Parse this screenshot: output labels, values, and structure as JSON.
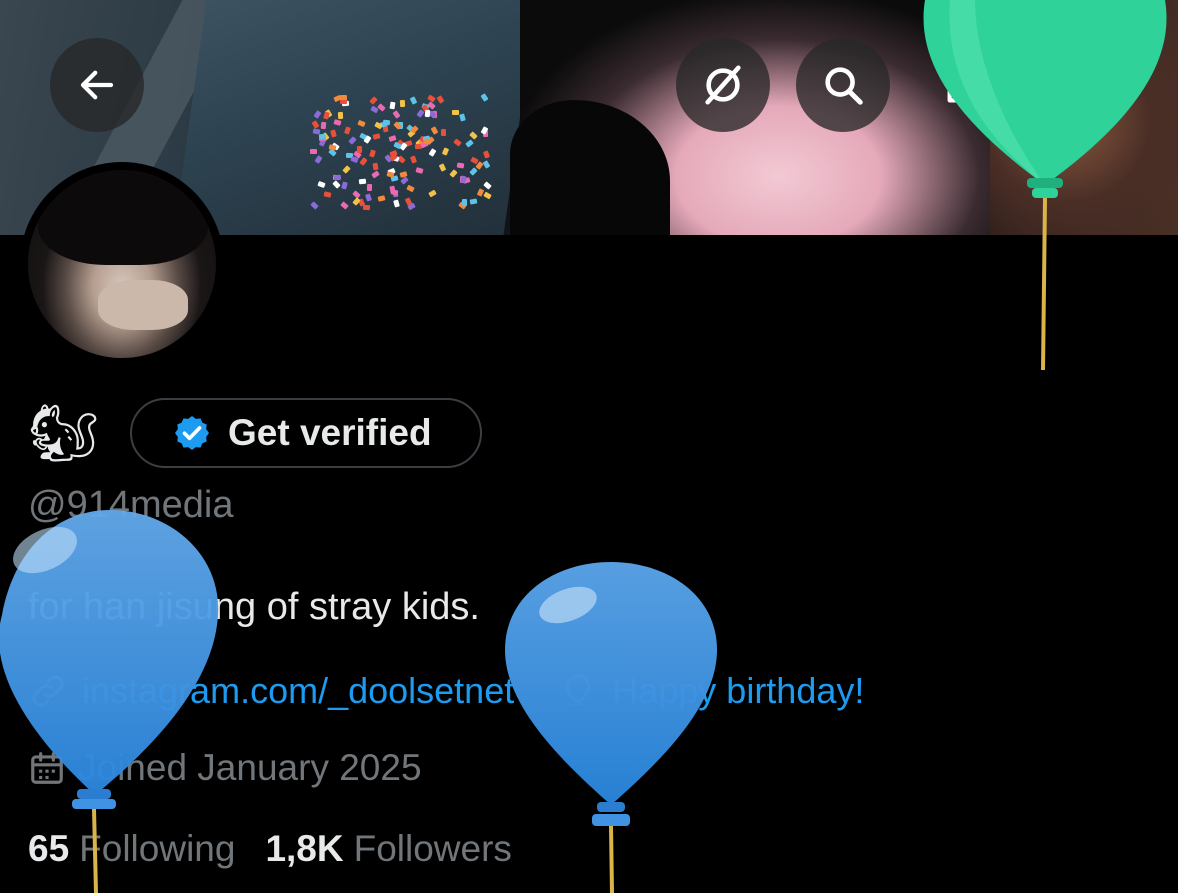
{
  "header": {
    "back_icon": "arrow-left-icon",
    "actions": [
      "grok-icon",
      "search-icon",
      "edit-icon",
      "share-icon"
    ]
  },
  "profile": {
    "display_name_emoji": "🐿",
    "get_verified_label": "Get verified",
    "handle": "@914media",
    "bio": "for han jisung of stray kids.",
    "link": "instagram.com/_doolsetnet",
    "birthday": "Happy birthday!",
    "joined": "Joined January 2025",
    "following_count": "65",
    "following_label": "Following",
    "followers_count": "1,8K",
    "followers_label": "Followers"
  },
  "colors": {
    "accent": "#1d9bf0",
    "muted": "#71767b",
    "text": "#e7e9ea",
    "balloon_blue": "#3d97e6",
    "balloon_green": "#2fd39a"
  }
}
